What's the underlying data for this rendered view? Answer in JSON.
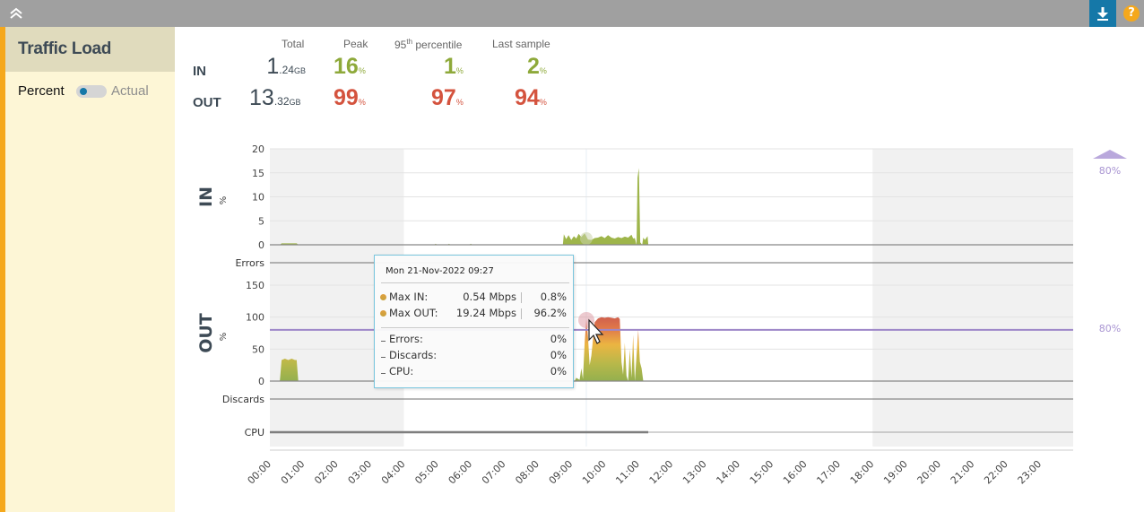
{
  "toolbar": {
    "collapse_icon": "double-chevron-up-icon",
    "download_icon": "download-icon",
    "help_label": "?",
    "accent_color": "#1578a8",
    "help_color": "#f5a81c"
  },
  "sidebar": {
    "title": "Traffic Load",
    "mode_left": "Percent",
    "mode_right": "Actual",
    "toggle_state": "Percent"
  },
  "stats": {
    "headers": [
      "Total",
      "Peak",
      "95th percentile",
      "Last sample"
    ],
    "header_95_base": "95",
    "header_95_sup": "th",
    "header_95_rest": " percentile",
    "rows": [
      {
        "label": "IN",
        "total_int": "1",
        "total_dec": ".24",
        "total_unit": "GB",
        "peak": "16",
        "p95": "1",
        "last": "2",
        "unit": "%",
        "status": "green"
      },
      {
        "label": "OUT",
        "total_int": "13",
        "total_dec": ".32",
        "total_unit": "GB",
        "peak": "99",
        "p95": "97",
        "last": "94",
        "unit": "%",
        "status": "red"
      }
    ]
  },
  "tooltip": {
    "date": "Mon 21-Nov-2022 09:27",
    "rows": [
      {
        "label": "Max IN:",
        "value": "0.54 Mbps",
        "pct": "0.8%"
      },
      {
        "label": "Max OUT:",
        "value": "19.24 Mbps",
        "pct": "96.2%"
      }
    ],
    "extra": [
      {
        "label": "Errors:",
        "pct": "0%"
      },
      {
        "label": "Discards:",
        "pct": "0%"
      },
      {
        "label": "CPU:",
        "pct": "0%"
      }
    ]
  },
  "chart_data": {
    "type": "area",
    "title": "Traffic Load",
    "x_ticks": [
      "00:00",
      "01:00",
      "02:00",
      "03:00",
      "04:00",
      "05:00",
      "06:00",
      "07:00",
      "08:00",
      "09:00",
      "10:00",
      "11:00",
      "12:00",
      "13:00",
      "14:00",
      "15:00",
      "16:00",
      "17:00",
      "18:00",
      "19:00",
      "20:00",
      "21:00",
      "22:00",
      "23:00"
    ],
    "x_range_hours": [
      0,
      24
    ],
    "shaded_ranges_hours": [
      [
        0,
        4
      ],
      [
        18,
        24
      ]
    ],
    "hover_time_hours": 9.45,
    "threshold": {
      "value": 80,
      "label": "80%",
      "color": "#9d86c8"
    },
    "panels": [
      {
        "name": "IN",
        "ylabel": "%",
        "yticks": [
          0,
          5,
          10,
          15,
          20
        ],
        "ylim": [
          0,
          20
        ],
        "color": "#9eb54a",
        "series": [
          [
            0.3,
            0
          ],
          [
            0.35,
            0.3
          ],
          [
            0.8,
            0.3
          ],
          [
            0.85,
            0
          ],
          [
            4.9,
            0
          ],
          [
            4.95,
            0.2
          ],
          [
            5.0,
            0
          ],
          [
            5.3,
            0
          ],
          [
            5.35,
            0.2
          ],
          [
            5.4,
            0
          ],
          [
            5.95,
            0
          ],
          [
            6.0,
            0.2
          ],
          [
            6.05,
            0
          ],
          [
            8.75,
            0
          ],
          [
            8.78,
            2.2
          ],
          [
            8.85,
            1.2
          ],
          [
            8.92,
            2.0
          ],
          [
            9.0,
            1.0
          ],
          [
            9.08,
            1.8
          ],
          [
            9.15,
            1.3
          ],
          [
            9.22,
            2.3
          ],
          [
            9.3,
            1.6
          ],
          [
            9.4,
            2.4
          ],
          [
            9.5,
            1.1
          ],
          [
            9.6,
            1.0
          ],
          [
            9.7,
            1.4
          ],
          [
            9.8,
            1.5
          ],
          [
            9.9,
            1.8
          ],
          [
            10.0,
            1.4
          ],
          [
            10.1,
            2.0
          ],
          [
            10.2,
            1.5
          ],
          [
            10.3,
            1.3
          ],
          [
            10.4,
            1.6
          ],
          [
            10.5,
            1.4
          ],
          [
            10.6,
            1.7
          ],
          [
            10.7,
            1.5
          ],
          [
            10.8,
            2.1
          ],
          [
            10.85,
            1.3
          ],
          [
            10.9,
            1.4
          ],
          [
            10.95,
            0
          ],
          [
            10.98,
            14
          ],
          [
            11.02,
            16
          ],
          [
            11.06,
            0.5
          ],
          [
            11.12,
            0
          ],
          [
            11.15,
            1.5
          ],
          [
            11.2,
            1.0
          ],
          [
            11.28,
            1.8
          ],
          [
            11.3,
            0
          ]
        ]
      },
      {
        "name": "OUT",
        "ylabel": "%",
        "yticks": [
          0,
          50,
          100,
          150
        ],
        "ylim": [
          0,
          150
        ],
        "color": "gradient-green-yellow-red",
        "series": [
          [
            0.25,
            0
          ],
          [
            0.3,
            1
          ],
          [
            0.35,
            33
          ],
          [
            0.45,
            35
          ],
          [
            0.55,
            33
          ],
          [
            0.65,
            35
          ],
          [
            0.75,
            33
          ],
          [
            0.8,
            33
          ],
          [
            0.85,
            0
          ],
          [
            9.1,
            0
          ],
          [
            9.15,
            5
          ],
          [
            9.25,
            2
          ],
          [
            9.3,
            20
          ],
          [
            9.35,
            3
          ],
          [
            9.4,
            60
          ],
          [
            9.45,
            96
          ],
          [
            9.5,
            70
          ],
          [
            9.55,
            25
          ],
          [
            9.6,
            40
          ],
          [
            9.7,
            92
          ],
          [
            9.8,
            98
          ],
          [
            9.9,
            100
          ],
          [
            10.0,
            99
          ],
          [
            10.1,
            100
          ],
          [
            10.2,
            99
          ],
          [
            10.3,
            98
          ],
          [
            10.4,
            100
          ],
          [
            10.45,
            97
          ],
          [
            10.5,
            30
          ],
          [
            10.55,
            10
          ],
          [
            10.6,
            60
          ],
          [
            10.65,
            8
          ],
          [
            10.7,
            0
          ],
          [
            10.75,
            50
          ],
          [
            10.8,
            5
          ],
          [
            10.85,
            72
          ],
          [
            10.9,
            0
          ],
          [
            11.0,
            80
          ],
          [
            11.05,
            30
          ],
          [
            11.1,
            20
          ],
          [
            11.15,
            0
          ]
        ]
      }
    ],
    "status_lanes": [
      "Errors",
      "Discards",
      "CPU"
    ]
  }
}
